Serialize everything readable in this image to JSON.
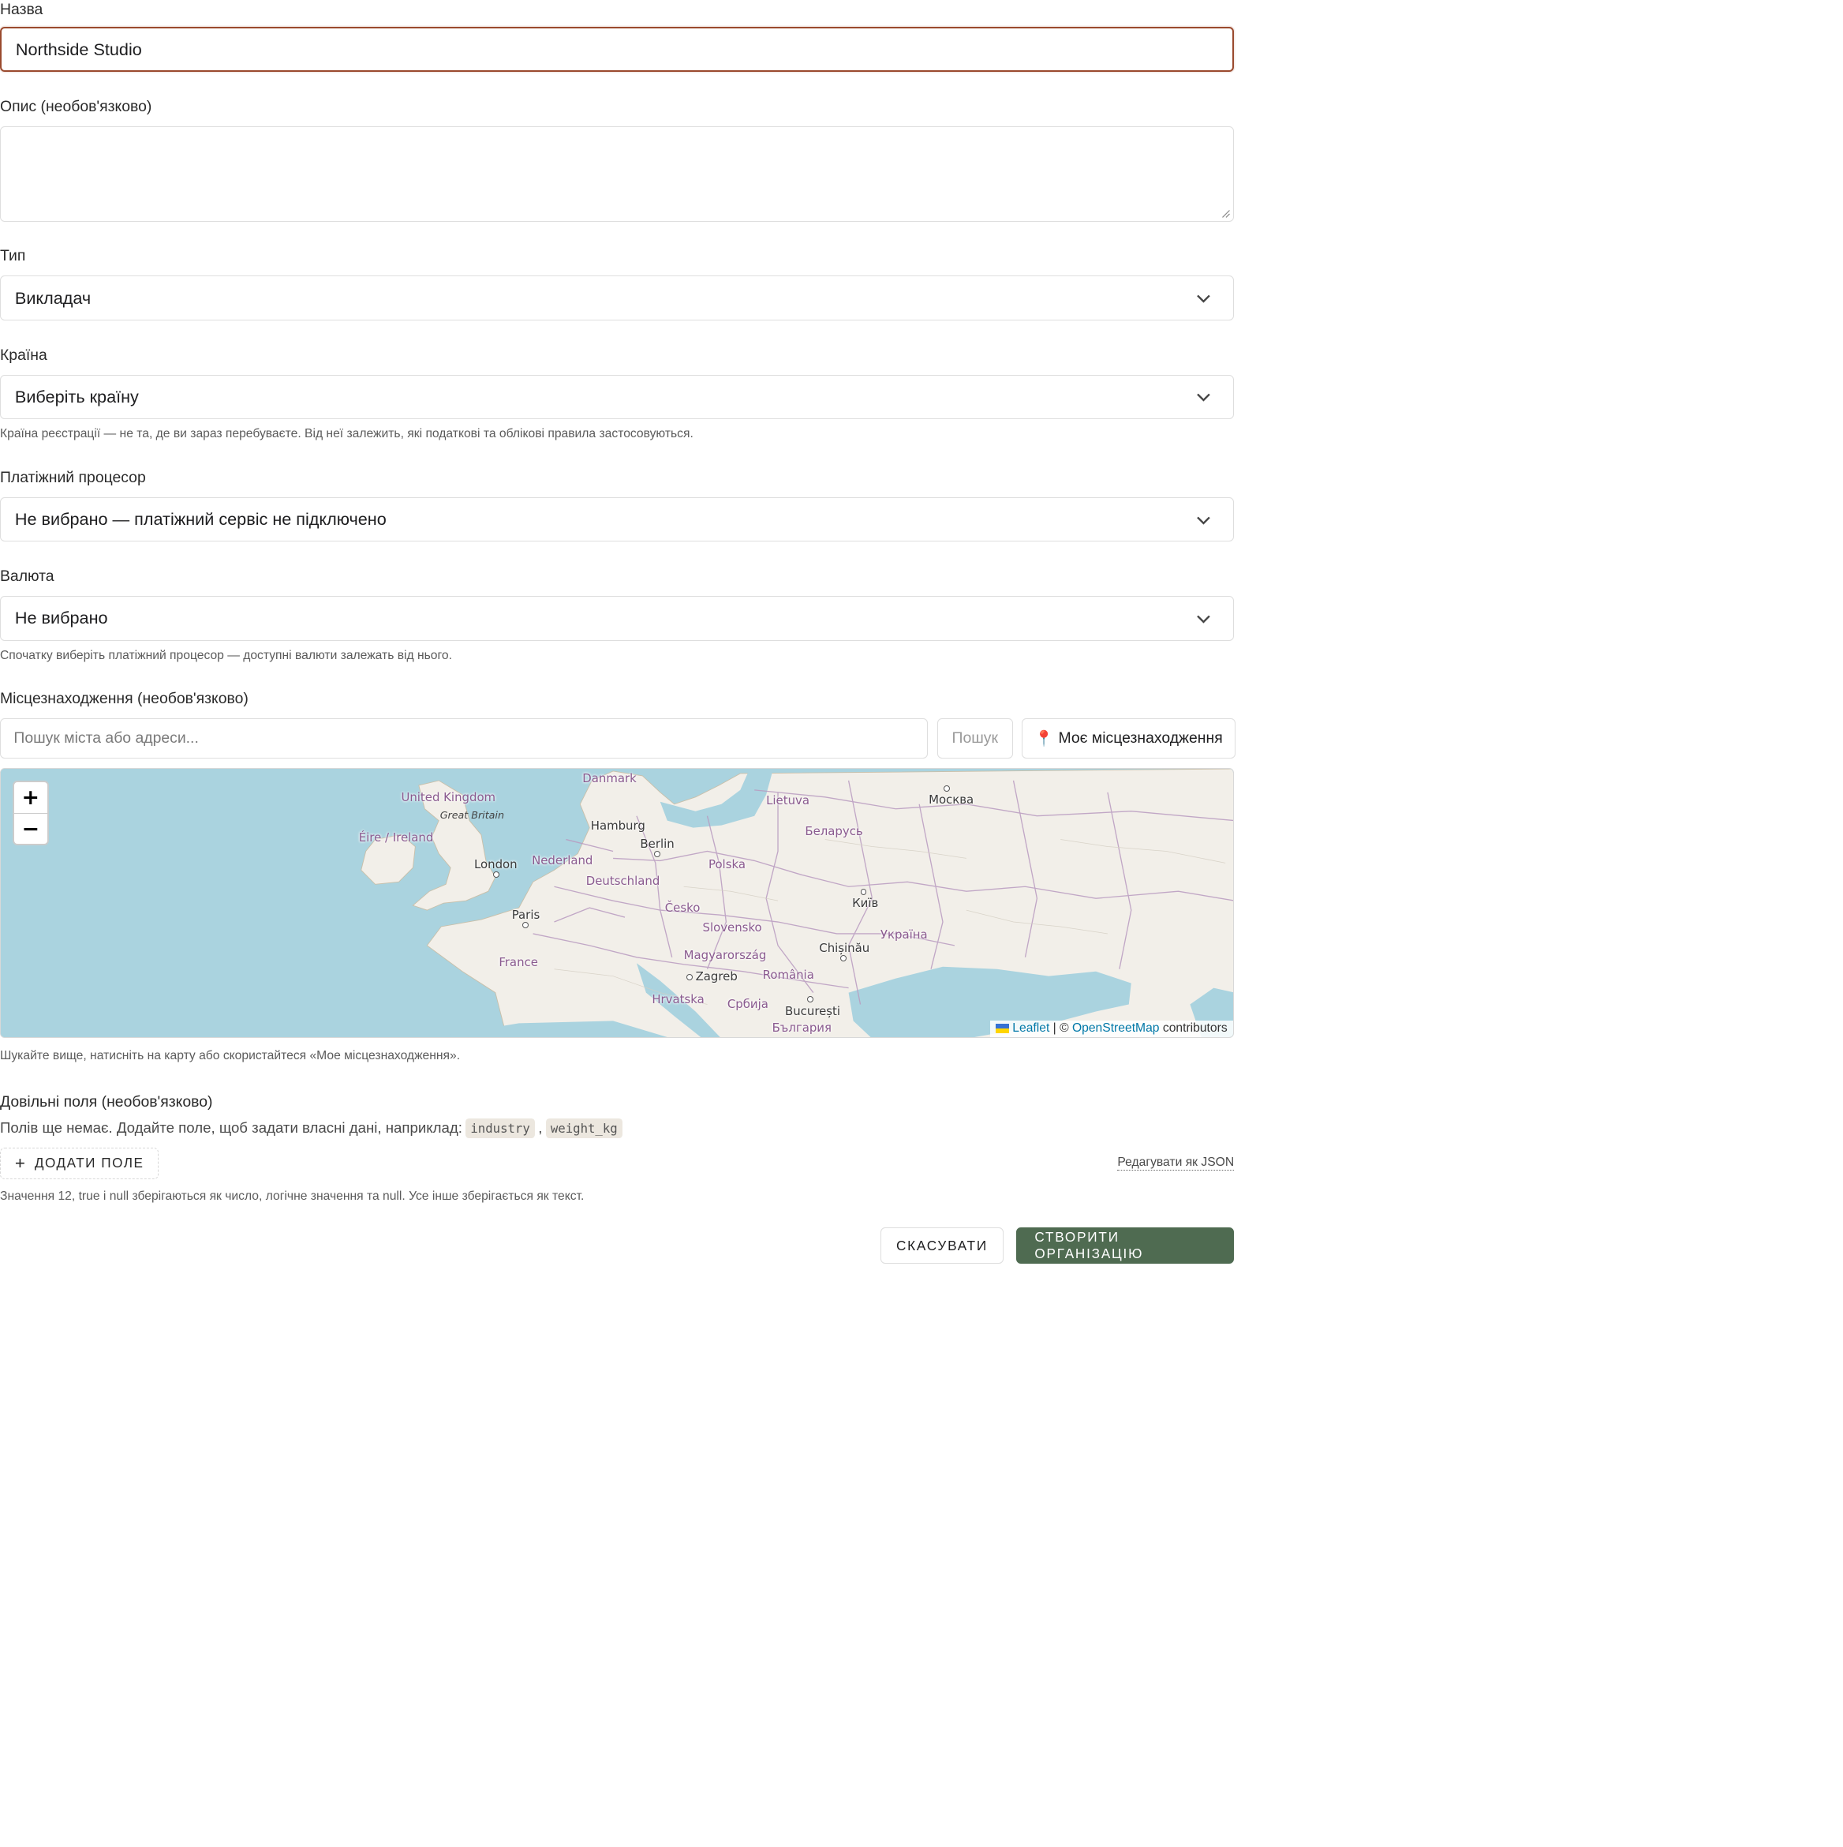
{
  "form": {
    "name": {
      "label": "Назва",
      "value": "Northside Studio"
    },
    "description": {
      "label": "Опис (необов'язково)",
      "value": ""
    },
    "type": {
      "label": "Тип",
      "value": "Викладач"
    },
    "country": {
      "label": "Країна",
      "value": "Виберіть країну",
      "help": "Країна реєстрації — не та, де ви зараз перебуваєте. Від неї залежить, які податкові та облікові правила застосовуються."
    },
    "processor": {
      "label": "Платіжний процесор",
      "value": "Не вибрано — платіжний сервіс не підключено"
    },
    "currency": {
      "label": "Валюта",
      "value": "Не вибрано",
      "help": "Спочатку виберіть платіжний процесор — доступні валюти залежать від нього."
    },
    "location": {
      "label": "Місцезнаходження (необов'язково)",
      "placeholder": "Пошук міста або адреси...",
      "search_label": "Пошук",
      "my_location_label": "Моє місцезнаходження",
      "help": "Шукайте вище, натисніть на карту або скористайтеся «Мое місцезнаходження»."
    },
    "custom_fields": {
      "title": "Довільні поля (необов'язково)",
      "empty_text": "Полів ще немає. Додайте поле, щоб задати власні дані, наприклад:",
      "examples": [
        "industry",
        "weight_kg"
      ],
      "add_label": "ДОДАТИ ПОЛЕ",
      "json_link": "Редагувати як JSON",
      "help": "Значення 12, true і null зберігаються як число, логічне значення та null. Усе інше зберігається як текст."
    }
  },
  "map": {
    "zoom_in": "+",
    "zoom_out": "−",
    "attribution": {
      "leaflet": "Leaflet",
      "sep": "| ©",
      "osm": "OpenStreetMap",
      "suffix": "contributors"
    },
    "labels": {
      "danmark": "Danmark",
      "uk": "United Kingdom",
      "gb": "Great Britain",
      "ireland": "Éire / Ireland",
      "london": "London",
      "hamburg": "Hamburg",
      "berlin": "Berlin",
      "nederland": "Nederland",
      "deutschland": "Deutschland",
      "polska": "Polska",
      "lietuva": "Lietuva",
      "belarus": "Беларусь",
      "moskva": "Москва",
      "paris": "Paris",
      "france": "France",
      "cesko": "Česko",
      "slovensko": "Slovensko",
      "kyiv": "Київ",
      "ukraina": "Україна",
      "chisinau": "Chișinău",
      "magyar": "Magyarország",
      "zagreb": "Zagreb",
      "romania": "România",
      "hrvatska": "Hrvatska",
      "srbija": "Србија",
      "bucuresti": "București",
      "bulgaria": "България"
    }
  },
  "actions": {
    "cancel": "СКАСУВАТИ",
    "create": "СТВОРИТИ ОРГАНІЗАЦІЮ"
  },
  "colors": {
    "focus_border": "#9a4a2e",
    "primary_button": "#4f6b51",
    "sea": "#aad3df",
    "land": "#f2efe9",
    "border_lines": "#b99bc0"
  },
  "icons": {
    "select_chevron": "chevron-down-icon",
    "location_pin": "pin-icon",
    "add": "plus-icon",
    "flag": "ukraine-flag-icon"
  }
}
